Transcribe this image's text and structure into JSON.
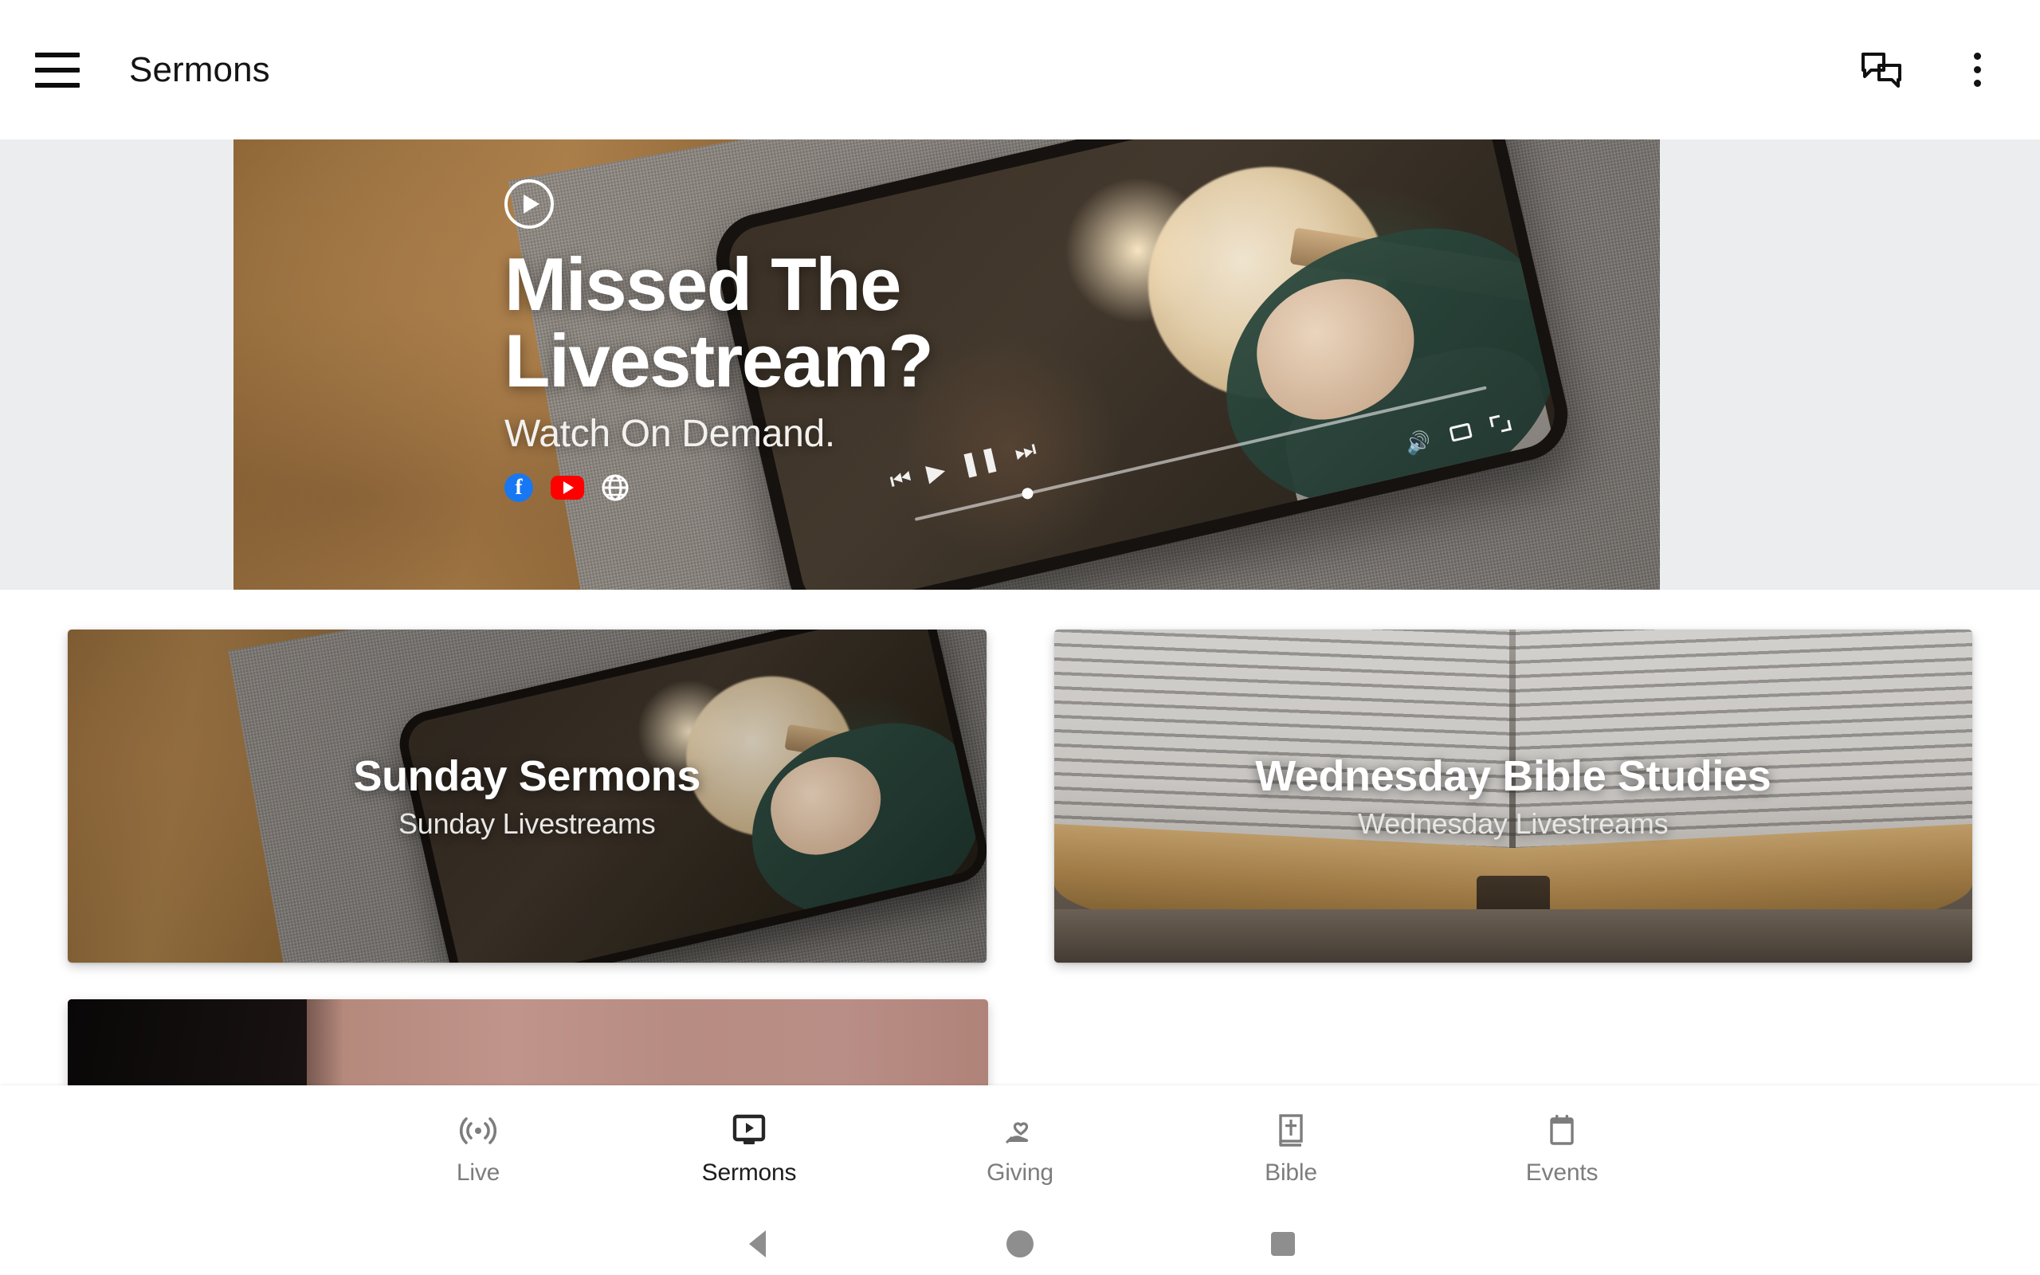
{
  "appbar": {
    "title": "Sermons",
    "menu_icon": "hamburger-menu-icon",
    "chat_icon": "chat-bubbles-icon",
    "overflow_icon": "more-vertical-icon"
  },
  "hero": {
    "play_icon": "play-circle-icon",
    "title_line1": "Missed The",
    "title_line2": "Livestream?",
    "subtitle": "Watch On Demand.",
    "social": [
      {
        "name": "facebook-icon",
        "label": "f",
        "color": "#1877F2"
      },
      {
        "name": "youtube-icon",
        "label": "",
        "color": "#FF0000"
      },
      {
        "name": "website-globe-icon",
        "label": "",
        "color": "#FFFFFF"
      }
    ],
    "background_color": "#EBEDEF"
  },
  "cards": [
    {
      "title": "Sunday Sermons",
      "subtitle": "Sunday Livestreams",
      "art": "phone-playing-worship-video-on-wooden-table"
    },
    {
      "title": "Wednesday Bible Studies",
      "subtitle": "Wednesday Livestreams",
      "art": "open-bible-on-wooden-table"
    },
    {
      "title": "",
      "subtitle": "",
      "art": "partially-visible-card"
    }
  ],
  "bottom_nav": {
    "items": [
      {
        "label": "Live",
        "icon": "broadcast-live-icon",
        "active": false
      },
      {
        "label": "Sermons",
        "icon": "tv-play-icon",
        "active": true
      },
      {
        "label": "Giving",
        "icon": "hand-heart-icon",
        "active": false
      },
      {
        "label": "Bible",
        "icon": "bible-book-icon",
        "active": false
      },
      {
        "label": "Events",
        "icon": "calendar-icon",
        "active": false
      }
    ],
    "active_color": "#1D1D1D",
    "inactive_color": "#7D7D7D"
  },
  "system_nav": {
    "back": "android-back-icon",
    "home": "android-home-icon",
    "recents": "android-recents-icon",
    "color": "#8E8E8E"
  }
}
